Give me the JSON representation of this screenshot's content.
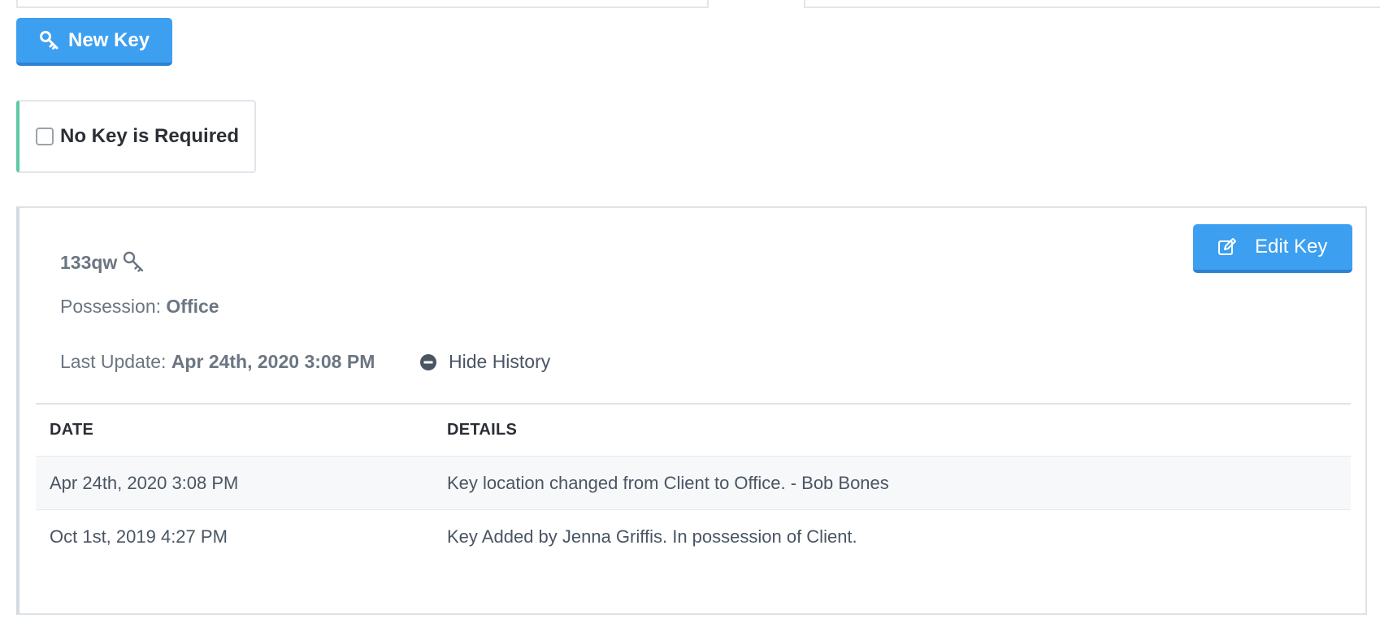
{
  "toolbar": {
    "new_key_label": "New Key"
  },
  "no_key_required": {
    "label": "No Key is Required",
    "checked": false
  },
  "key": {
    "name": "133qw",
    "possession_label": "Possession:",
    "possession_value": "Office",
    "last_update_label": "Last Update:",
    "last_update_value": "Apr 24th, 2020 3:08 PM",
    "hide_history_label": "Hide History",
    "edit_label": "Edit Key"
  },
  "history": {
    "columns": [
      "DATE",
      "DETAILS"
    ],
    "rows": [
      {
        "date": "Apr 24th, 2020 3:08 PM",
        "details": "Key location changed from Client to Office. - Bob Bones"
      },
      {
        "date": "Oct 1st, 2019 4:27 PM",
        "details": "Key Added by Jenna Griffis. In possession of Client."
      }
    ]
  },
  "colors": {
    "primary_button": "#3d9ff0",
    "accent_green": "#5fc9a5"
  }
}
